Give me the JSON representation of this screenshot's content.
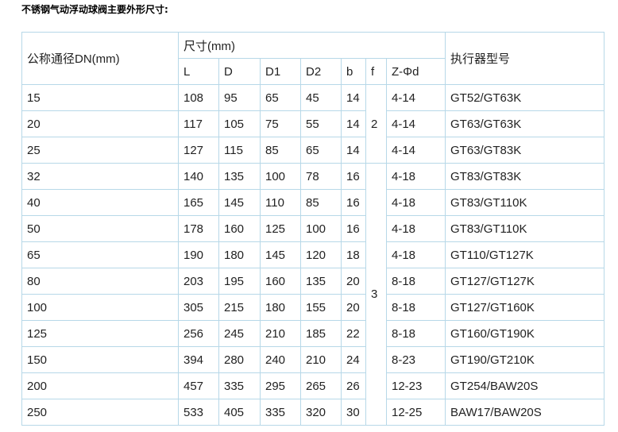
{
  "title": "不锈钢气动浮动球阀主要外形尺寸:",
  "table": {
    "header_dn": "公称通径DN(mm)",
    "header_size_group": "尺寸(mm)",
    "header_actuator": "执行器型号",
    "columns": [
      "L",
      "D",
      "D1",
      "D2",
      "b",
      "f",
      "Z-Φd"
    ],
    "f_groups": [
      "2",
      "3"
    ],
    "rows": [
      {
        "dn": "15",
        "L": "108",
        "D": "95",
        "D1": "65",
        "D2": "45",
        "b": "14",
        "zd": "4-14",
        "actuator": "GT52/GT63K"
      },
      {
        "dn": "20",
        "L": "117",
        "D": "105",
        "D1": "75",
        "D2": "55",
        "b": "14",
        "zd": "4-14",
        "actuator": "GT63/GT63K"
      },
      {
        "dn": "25",
        "L": "127",
        "D": "115",
        "D1": "85",
        "D2": "65",
        "b": "14",
        "zd": "4-14",
        "actuator": "GT63/GT83K"
      },
      {
        "dn": "32",
        "L": "140",
        "D": "135",
        "D1": "100",
        "D2": "78",
        "b": "16",
        "zd": "4-18",
        "actuator": "GT83/GT83K"
      },
      {
        "dn": "40",
        "L": "165",
        "D": "145",
        "D1": "110",
        "D2": "85",
        "b": "16",
        "zd": "4-18",
        "actuator": "GT83/GT110K"
      },
      {
        "dn": "50",
        "L": "178",
        "D": "160",
        "D1": "125",
        "D2": "100",
        "b": "16",
        "zd": "4-18",
        "actuator": "GT83/GT110K"
      },
      {
        "dn": "65",
        "L": "190",
        "D": "180",
        "D1": "145",
        "D2": "120",
        "b": "18",
        "zd": "4-18",
        "actuator": "GT110/GT127K"
      },
      {
        "dn": "80",
        "L": "203",
        "D": "195",
        "D1": "160",
        "D2": "135",
        "b": "20",
        "zd": "8-18",
        "actuator": "GT127/GT127K"
      },
      {
        "dn": "100",
        "L": "305",
        "D": "215",
        "D1": "180",
        "D2": "155",
        "b": "20",
        "zd": "8-18",
        "actuator": "GT127/GT160K"
      },
      {
        "dn": "125",
        "L": "256",
        "D": "245",
        "D1": "210",
        "D2": "185",
        "b": "22",
        "zd": "8-18",
        "actuator": "GT160/GT190K"
      },
      {
        "dn": "150",
        "L": "394",
        "D": "280",
        "D1": "240",
        "D2": "210",
        "b": "24",
        "zd": "8-23",
        "actuator": "GT190/GT210K"
      },
      {
        "dn": "200",
        "L": "457",
        "D": "335",
        "D1": "295",
        "D2": "265",
        "b": "26",
        "zd": "12-23",
        "actuator": "GT254/BAW20S"
      },
      {
        "dn": "250",
        "L": "533",
        "D": "405",
        "D1": "335",
        "D2": "320",
        "b": "30",
        "zd": "12-25",
        "actuator": "BAW17/BAW20S"
      }
    ]
  },
  "colors": {
    "border": "#b7d8e8",
    "text": "#222222",
    "title": "#000000"
  }
}
